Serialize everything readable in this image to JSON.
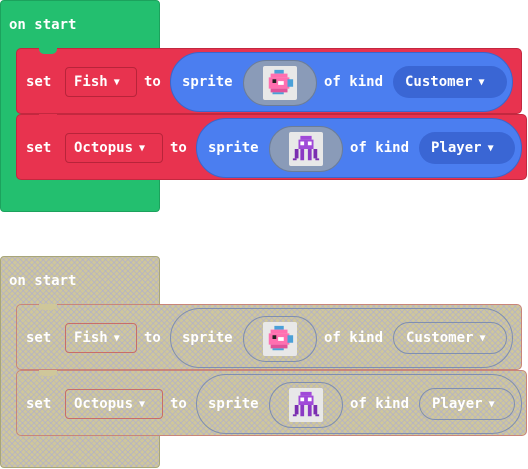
{
  "blocks": [
    {
      "state": "active",
      "hat_label": "on start",
      "statements": [
        {
          "set_label": "set",
          "variable": "Fish",
          "to_label": "to",
          "sprite_label": "sprite",
          "image_icon": "pink-fish-sprite",
          "of_kind_label": "of kind",
          "kind": "Customer"
        },
        {
          "set_label": "set",
          "variable": "Octopus",
          "to_label": "to",
          "sprite_label": "sprite",
          "image_icon": "purple-octopus-sprite",
          "of_kind_label": "of kind",
          "kind": "Player"
        }
      ]
    },
    {
      "state": "disabled",
      "hat_label": "on start",
      "statements": [
        {
          "set_label": "set",
          "variable": "Fish",
          "to_label": "to",
          "sprite_label": "sprite",
          "image_icon": "pink-fish-sprite",
          "of_kind_label": "of kind",
          "kind": "Customer"
        },
        {
          "set_label": "set",
          "variable": "Octopus",
          "to_label": "to",
          "sprite_label": "sprite",
          "image_icon": "purple-octopus-sprite",
          "of_kind_label": "of kind",
          "kind": "Player"
        }
      ]
    }
  ],
  "colors": {
    "event_green": "#23bf6f",
    "variable_red": "#e8334f",
    "sprite_blue": "#4b7ef0",
    "disabled_khaki": "#cfc79a"
  }
}
